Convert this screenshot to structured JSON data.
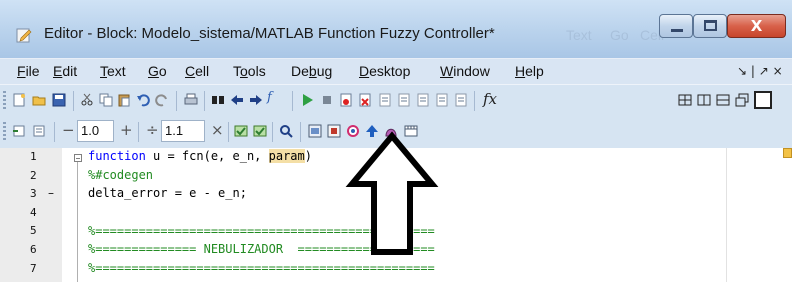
{
  "window": {
    "title": "Editor - Block: Modelo_sistema/MATLAB Function Fuzzy Controller*",
    "background_ghost_text": [
      "Text",
      "Go",
      "Cell"
    ],
    "close_glyph": "X"
  },
  "menu": {
    "items": [
      {
        "accel": "F",
        "rest": "ile"
      },
      {
        "accel": "E",
        "rest": "dit"
      },
      {
        "accel": "T",
        "rest": "ext"
      },
      {
        "accel": "G",
        "rest": "o"
      },
      {
        "accel": "C",
        "rest": "ell"
      },
      {
        "pre": "T",
        "accel": "o",
        "rest": "ols"
      },
      {
        "pre": "De",
        "accel": "b",
        "rest": "ug"
      },
      {
        "accel": "D",
        "rest": "esktop"
      },
      {
        "accel": "W",
        "rest": "indow"
      },
      {
        "accel": "H",
        "rest": "elp"
      }
    ],
    "dock_controls": "↘ | ↗ ×"
  },
  "toolbar1": {
    "fx_label": "fx",
    "icons": [
      "new-file-icon",
      "open-folder-icon",
      "save-icon",
      "cut-icon",
      "copy-icon",
      "paste-icon",
      "undo-icon",
      "redo-icon",
      "print-icon",
      "find-icon",
      "back-icon",
      "forward-icon",
      "function-browser-icon",
      "run-icon",
      "stop-icon",
      "set-breakpoint-icon",
      "clear-breakpoints-icon",
      "step-icon",
      "step-in-icon",
      "step-out-icon",
      "continue-icon",
      "exit-debug-icon",
      "tile-icon",
      "split-vertical-icon",
      "split-horizontal-icon",
      "float-icon",
      "maximize-icon"
    ]
  },
  "toolbar2": {
    "cell_decrement": "−",
    "cell_value_1": "1.0",
    "cell_increment": "+",
    "divide": "÷",
    "cell_value_2": "1.1",
    "multiply": "×",
    "icons": [
      "insert-cell-icon",
      "cell-mode-icon",
      "eval-cell-icon",
      "eval-advance-icon",
      "help-icon",
      "model-explorer-icon",
      "edit-data-icon",
      "target-icon",
      "go-to-parent-icon",
      "stateflow-icon",
      "ports-icon"
    ]
  },
  "editor": {
    "lines": [
      {
        "num": "1",
        "marker": "",
        "text_kw": "function",
        "text_rest": " u = fcn(e, e_n, ",
        "text_hl": "param",
        "text_end": ")"
      },
      {
        "num": "2",
        "marker": "",
        "comment": "%#codegen"
      },
      {
        "num": "3",
        "marker": "–",
        "code": "delta_error = e - e_n;"
      },
      {
        "num": "4",
        "marker": "",
        "code": ""
      },
      {
        "num": "5",
        "marker": "",
        "comment": "%==============================================="
      },
      {
        "num": "6",
        "marker": "",
        "comment": "%============== NEBULIZADOR  ==================="
      },
      {
        "num": "7",
        "marker": "",
        "comment": "%==============================================="
      }
    ]
  },
  "colors": {
    "keyword": "#0000ff",
    "comment": "#228b22",
    "highlight": "#f4dfa6",
    "toolbar_bg": "#d6e4f2"
  }
}
